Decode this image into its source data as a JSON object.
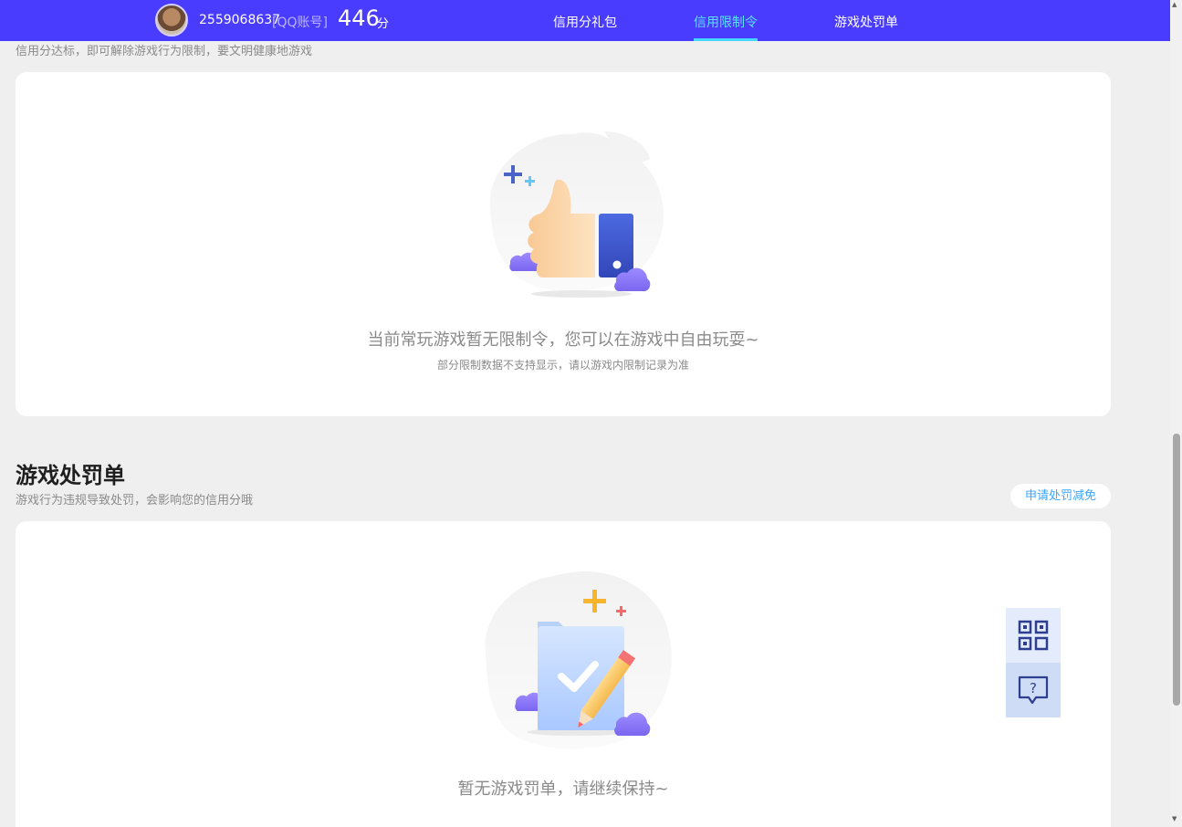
{
  "header": {
    "account_id": "2559068637",
    "account_type": "[QQ账号]",
    "score": "446",
    "score_unit": "分",
    "nav": [
      {
        "label": "信用分礼包",
        "active": false
      },
      {
        "label": "信用限制令",
        "active": true
      },
      {
        "label": "游戏处罚单",
        "active": false
      }
    ]
  },
  "restriction": {
    "subtitle": "信用分达标，即可解除游戏行为限制，要文明健康地游戏",
    "empty_text": "当前常玩游戏暂无限制令，您可以在游戏中自由玩耍~",
    "empty_note": "部分限制数据不支持显示，请以游戏内限制记录为准",
    "illustration_icon": "thumbs-up-icon"
  },
  "penalty": {
    "title": "游戏处罚单",
    "subtitle": "游戏行为违规导致处罚，会影响您的信用分哦",
    "apply_label": "申请处罚减免",
    "empty_text": "暂无游戏罚单，请继续保持~",
    "illustration_icon": "checklist-pencil-icon"
  },
  "float_panel": {
    "items": [
      "qr-code-icon",
      "help-chat-icon"
    ]
  },
  "colors": {
    "header_bg": "#4a3cff",
    "active_nav": "#5ce0ff",
    "accent_link": "#3aa6ff",
    "page_bg": "#efefef"
  }
}
